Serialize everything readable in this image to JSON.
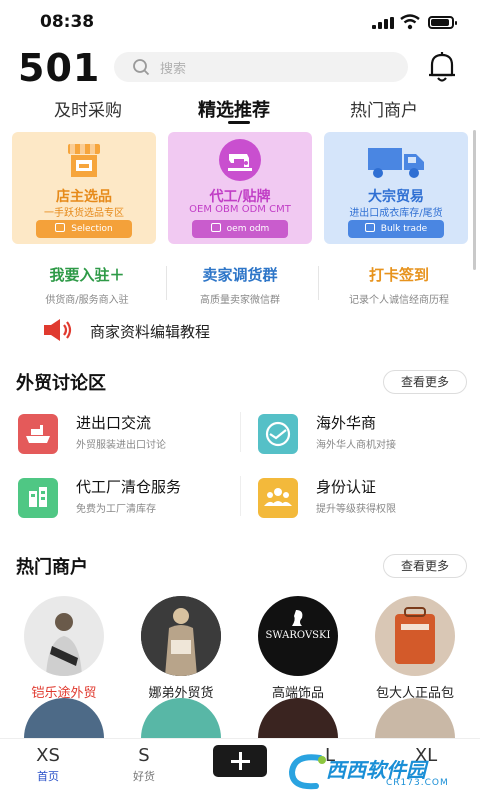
{
  "status_bar": {
    "time": "08:38"
  },
  "header": {
    "logo": "501",
    "search_placeholder": "搜索"
  },
  "tabs": [
    {
      "label": "及时采购"
    },
    {
      "label": "精选推荐"
    },
    {
      "label": "热门商户"
    }
  ],
  "cards": [
    {
      "title": "店主选品",
      "subtitle": "一手跃货选品专区",
      "pill": "Selection",
      "bg": "#fde8c6",
      "title_color": "#e68a1a",
      "pill_color": "#f4a13a"
    },
    {
      "title": "代工/贴牌",
      "subtitle": "OEM OBM ODM CMT",
      "pill": "oem odm",
      "bg": "#f1c9f2",
      "title_color": "#c13ec6",
      "pill_color": "#c95ccd"
    },
    {
      "title": "大宗贸易",
      "subtitle": "进出口成衣库存/尾货",
      "pill": "Bulk trade",
      "bg": "#d5e5fa",
      "title_color": "#2f6fd3",
      "pill_color": "#4a86e2"
    }
  ],
  "quick_actions": [
    {
      "title": "我要入驻＋",
      "subtitle": "供货商/服务商入驻",
      "color": "#2e9a47"
    },
    {
      "title": "卖家调货群",
      "subtitle": "高质量卖家微信群",
      "color": "#2e76c8"
    },
    {
      "title": "打卡签到",
      "subtitle": "记录个人诚信经商历程",
      "color": "#e7931d"
    }
  ],
  "tutorial": {
    "text": "商家资料编辑教程"
  },
  "forum": {
    "title": "外贸讨论区",
    "more": "查看更多",
    "items": [
      {
        "title": "进出口交流",
        "subtitle": "外贸服装进出口讨论",
        "color": "#e45a5a"
      },
      {
        "title": "海外华商",
        "subtitle": "海外华人商机对接",
        "color": "#55c0c7"
      },
      {
        "title": "代工厂清仓服务",
        "subtitle": "免费为工厂清库存",
        "color": "#4fc784"
      },
      {
        "title": "身份认证",
        "subtitle": "提升等级获得权限",
        "color": "#f3b93b"
      }
    ]
  },
  "merchants": {
    "title": "热门商户",
    "more": "查看更多",
    "items": [
      {
        "name": "铠乐途外贸",
        "highlight": true
      },
      {
        "name": "娜弟外贸货",
        "highlight": false
      },
      {
        "name": "高端饰品",
        "highlight": false,
        "logo_text": "SWAROVSKI"
      },
      {
        "name": "包大人正品包",
        "highlight": false
      }
    ]
  },
  "bottom_nav": [
    {
      "letter": "XS",
      "label": "首页",
      "active": true
    },
    {
      "letter": "S",
      "label": "好货",
      "active": false
    },
    {
      "letter": "L",
      "label": "",
      "active": false
    },
    {
      "letter": "XL",
      "label": "",
      "active": false
    }
  ],
  "watermark": {
    "text": "西西软件园",
    "sub": "CR173.COM"
  }
}
